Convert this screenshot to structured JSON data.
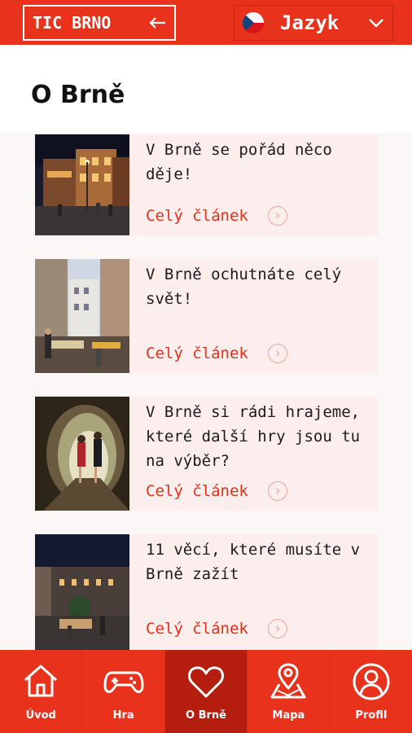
{
  "header": {
    "logo_label": "TIC BRNO",
    "language_label": "Jazyk",
    "brand_color": "#e8321c",
    "icons": {
      "back": "arrow-left-icon",
      "flag": "czech-flag-icon",
      "dropdown": "chevron-down-icon"
    }
  },
  "page": {
    "title": "O Brně"
  },
  "articles": [
    {
      "title": "V Brně se pořád něco děje!",
      "link_label": "Celý článek"
    },
    {
      "title": "V Brně ochutnáte celý svět!",
      "link_label": "Celý článek"
    },
    {
      "title": "V Brně si rádi hrajeme, které další hry jsou tu na výběr?",
      "link_label": "Celý článek"
    },
    {
      "title": "11 věcí, které musíte v Brně zažít",
      "link_label": "Celý článek"
    }
  ],
  "bottom_nav": {
    "items": [
      {
        "label": "Úvod",
        "icon": "home-icon"
      },
      {
        "label": "Hra",
        "icon": "gamepad-icon"
      },
      {
        "label": "O Brně",
        "icon": "heart-icon",
        "active": true
      },
      {
        "label": "Mapa",
        "icon": "map-pin-icon"
      },
      {
        "label": "Profil",
        "icon": "user-icon"
      }
    ]
  }
}
